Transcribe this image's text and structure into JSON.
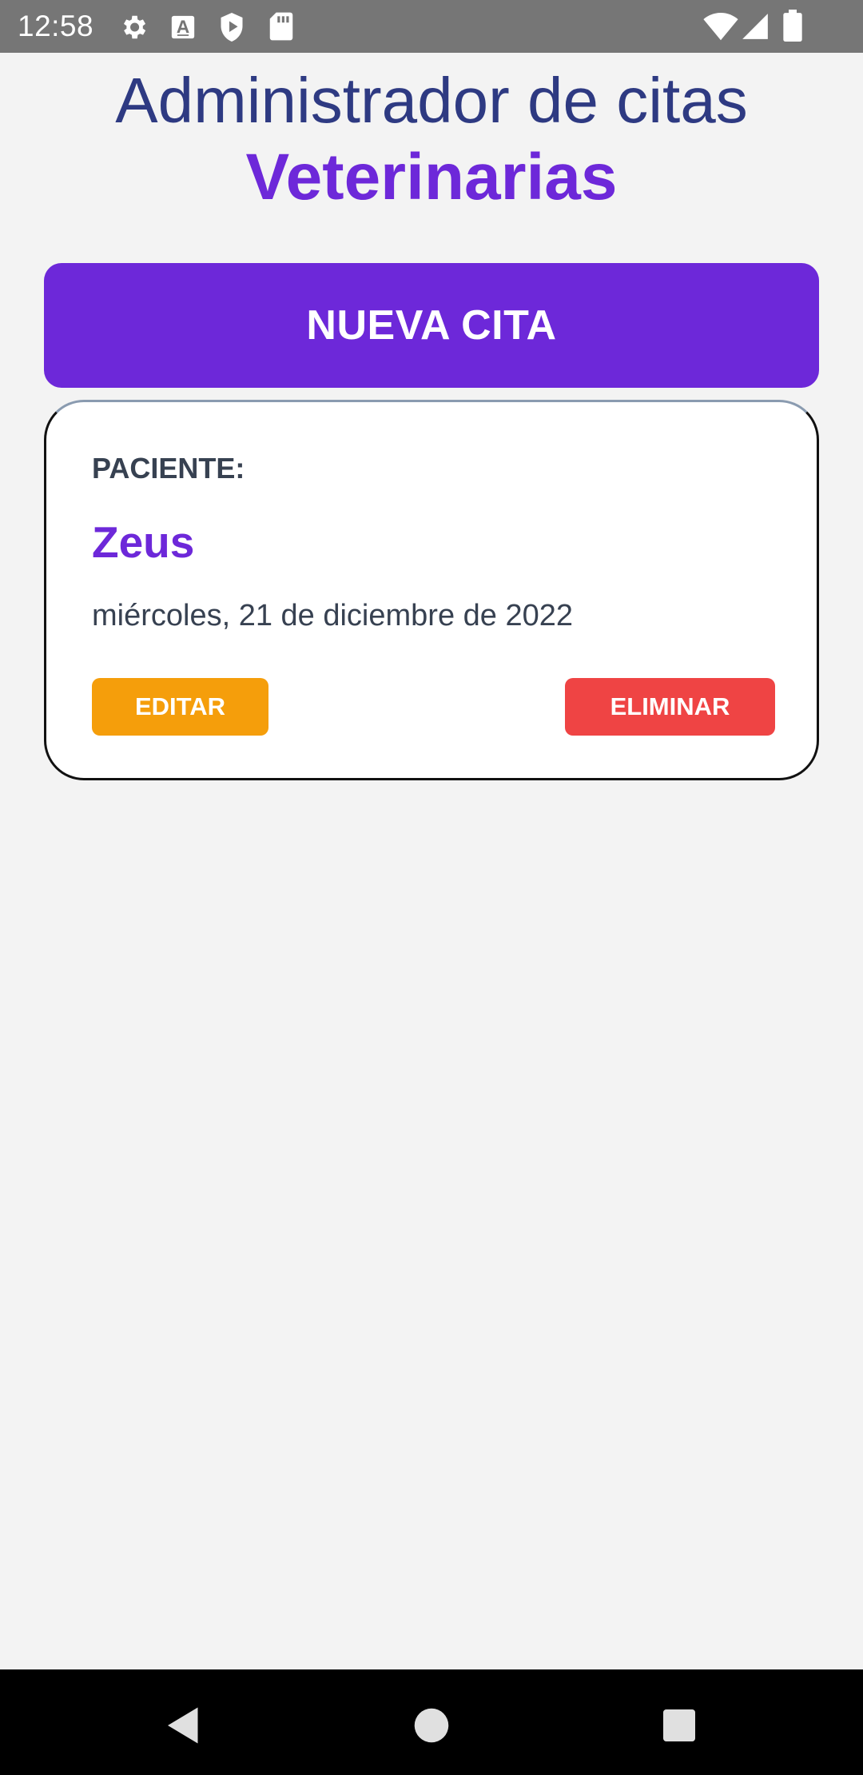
{
  "status_bar": {
    "time": "12:58",
    "left_icons": [
      "gear-icon",
      "font-a-icon",
      "play-shield-icon",
      "sd-card-icon"
    ],
    "right_icons": [
      "wifi-icon",
      "cell-signal-icon",
      "battery-icon"
    ],
    "background_color": "#767676"
  },
  "header": {
    "title_line1": "Administrador de citas",
    "title_line2": "Veterinarias"
  },
  "new_appointment_button": {
    "label": "NUEVA CITA"
  },
  "appointment_card": {
    "patient_label": "PACIENTE:",
    "patient_name": "Zeus",
    "date": "miércoles, 21 de diciembre de 2022",
    "edit_label": "EDITAR",
    "delete_label": "ELIMINAR"
  },
  "nav_bar": {
    "buttons": [
      "back-icon",
      "home-icon",
      "recents-icon"
    ]
  },
  "colors": {
    "primary": "#6d28d9",
    "title": "#2e3a82",
    "edit": "#f59e0b",
    "delete": "#ef4444",
    "background": "#f3f3f3"
  }
}
